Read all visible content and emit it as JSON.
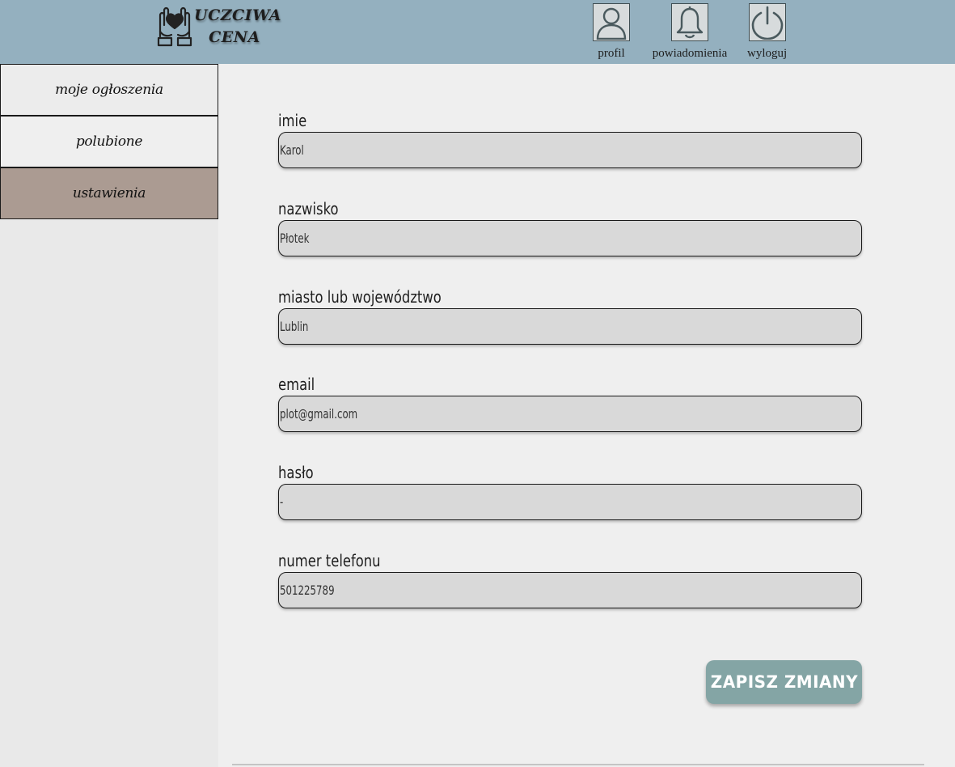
{
  "header": {
    "logo_line1": "UCZCIWA",
    "logo_line2": "CENA",
    "nav": [
      {
        "label": "profil",
        "icon": "user-icon"
      },
      {
        "label": "powiadomienia",
        "icon": "bell-icon"
      },
      {
        "label": "wyloguj",
        "icon": "power-icon"
      }
    ]
  },
  "sidebar": {
    "items": [
      {
        "label": "moje ogłoszenia",
        "active": false
      },
      {
        "label": "polubione",
        "active": false
      },
      {
        "label": "ustawienia",
        "active": true
      }
    ]
  },
  "form": {
    "fields": [
      {
        "label": "imie",
        "value": "Karol"
      },
      {
        "label": "nazwisko",
        "value": "Płotek"
      },
      {
        "label": "miasto lub województwo",
        "value": "Lublin"
      },
      {
        "label": "email",
        "value": "plot@gmail.com"
      },
      {
        "label": "hasło",
        "value": "-"
      },
      {
        "label": "numer telefonu",
        "value": "501225789"
      }
    ],
    "save_label": "ZAPISZ ZMIANY"
  },
  "colors": {
    "header_bg": "#94b0bf",
    "active_sidebar": "#ab9b92",
    "save_button": "#84a5a5",
    "input_bg": "#d9d9d9"
  }
}
